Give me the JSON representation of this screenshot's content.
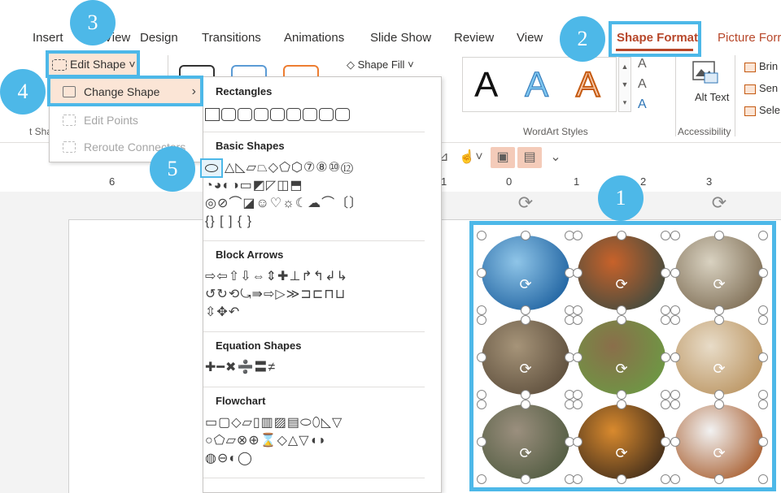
{
  "tabs": [
    {
      "label": "Insert"
    },
    {
      "label": "View"
    },
    {
      "label": "Design"
    },
    {
      "label": "Transitions"
    },
    {
      "label": "Animations"
    },
    {
      "label": "Slide Show"
    },
    {
      "label": "Review"
    },
    {
      "label": "View"
    },
    {
      "label": "Shape Format"
    },
    {
      "label": "Picture Forr"
    }
  ],
  "ribbon": {
    "shape_fill": "Shape Fill",
    "wordart_letter": "A",
    "wordart_group": "WordArt Styles",
    "alt_text": "Alt Text",
    "accessibility_group": "Accessibility",
    "arrange": [
      "Brin",
      "Sen",
      "Sele"
    ],
    "left_fragment": "t Sha"
  },
  "edit_shape": {
    "label": "Edit Shape",
    "menu": [
      {
        "label": "Change Shape",
        "state": "active"
      },
      {
        "label": "Edit Points",
        "state": "disabled"
      },
      {
        "label": "Reroute Connectors",
        "state": "disabled"
      }
    ]
  },
  "gallery": {
    "sections": [
      "Rectangles",
      "Basic Shapes",
      "Block Arrows",
      "Equation Shapes",
      "Flowchart"
    ],
    "basic_row2": "◔◕◐◑▭◩◸◫⬒",
    "basic_row3": "◎⊘⌒◪☺♡☼☾☁⌒〔〕",
    "basic_row4": "{} [ ] { }",
    "arrows_row1": "⇨⇦⇧⇩⇔⇕✚⊥↱↰↲↳",
    "arrows_row2": "↺↻⟲⤿⇛⇨▷≫⊐⊏⊓⊔",
    "arrows_row3": "⇳✥↶",
    "equation_row": "✚━✖➗〓≠",
    "flow_row1": "▭▢◇▱▯▥▨▤⬭⬯◺▽",
    "flow_row2": "○⬠▱⊗⊕⌛◇△▽◖◗",
    "flow_row3": "◍⊖◐◯"
  },
  "ruler": [
    "6",
    "1",
    "0",
    "1",
    "2",
    "3"
  ],
  "callouts": [
    "1",
    "2",
    "3",
    "4",
    "5"
  ],
  "photos": [
    {
      "name": "whale",
      "colors": [
        "#8fc5e8",
        "#1b5f9e"
      ]
    },
    {
      "name": "koi",
      "colors": [
        "#c8622a",
        "#3c4a40"
      ]
    },
    {
      "name": "dogs",
      "colors": [
        "#d9d2c1",
        "#7b6a51"
      ]
    },
    {
      "name": "meerkats",
      "colors": [
        "#a69479",
        "#5b4c3a"
      ]
    },
    {
      "name": "rabbit",
      "colors": [
        "#8a6e4a",
        "#6c9a44"
      ]
    },
    {
      "name": "owl",
      "colors": [
        "#e8dcc8",
        "#b9925e"
      ]
    },
    {
      "name": "kittens",
      "colors": [
        "#9b8f7e",
        "#4f5a3f"
      ]
    },
    {
      "name": "tiger",
      "colors": [
        "#d98a2e",
        "#3c2a1a"
      ]
    },
    {
      "name": "white-cat",
      "colors": [
        "#f2f2f2",
        "#a65a2a"
      ]
    }
  ]
}
